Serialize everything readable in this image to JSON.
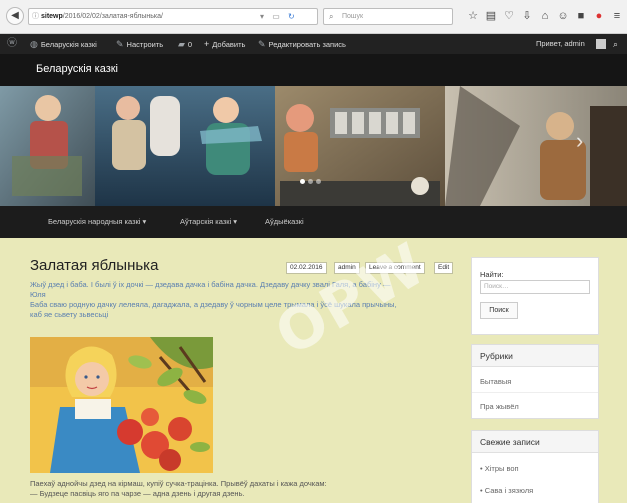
{
  "browser": {
    "url_host": "sitewp",
    "url_path": "/2016/02/02/залатая-яблынька/",
    "search_placeholder": "Пошук"
  },
  "admin_bar": {
    "site_name": "Беларускія казкі",
    "customize": "Настроить",
    "comments_count": "0",
    "add_new": "Добавить",
    "edit_post": "Редактировать запись",
    "greeting": "Привет, admin"
  },
  "site": {
    "title": "Беларускія казкі"
  },
  "nav": {
    "items": [
      {
        "label": "Беларускія народныя казкі ▾"
      },
      {
        "label": "Аўтарскія казкі ▾"
      },
      {
        "label": "Аўдыёказкі"
      }
    ]
  },
  "post": {
    "title": "Залатая яблынька",
    "date": "02.02.2016",
    "author": "admin",
    "leave_comment": "Leave a comment",
    "edit": "Edit",
    "excerpt_line1": "Жыў дзед і баба. І былі ў іх дочкі — дзедава дачка і бабіна дачка. Дзедаву дачку звалі Галя, а бабіну —",
    "excerpt_line2": "Юля",
    "excerpt_line3": "Баба сваю родную дачку лелеяла, дагаджала, а дзедаву ў чорным целе трымала і ўсё шукала прычыны,",
    "excerpt_line4": "каб яе сьвету зьвесьці",
    "after_line1": "Паехаў аднойчы дзед на кірмаш, купіў сучка-трацінка. Прывёў дахаты і кажа дочкам:",
    "after_line2": "— Будзеце пасвіць яго па чарзе — адна дзень і другая дзень."
  },
  "sidebar": {
    "search_label": "Найти:",
    "search_placeholder": "Поиск…",
    "search_button": "Поиск",
    "categories_title": "Рубрики",
    "categories": [
      "Бытавыя",
      "Пра жывёл"
    ],
    "recent_title": "Свежие записи",
    "recent": [
      "Хітры воп",
      "Сава і зязюля"
    ]
  },
  "watermark": "OPW",
  "colors": {
    "page_bg": "#e9e9b9",
    "admin_bar": "#222222",
    "header": "#151515",
    "nav": "#1c1c1c"
  }
}
